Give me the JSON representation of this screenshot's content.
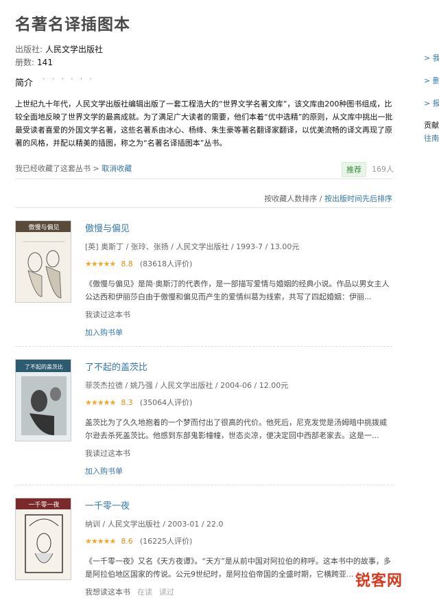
{
  "header": {
    "title": "名著名译插图本",
    "publisher_label": "出版社:",
    "publisher": "人民文学出版社",
    "count_label": "册数:",
    "count": "141",
    "intro_heading": "简介",
    "dots": "· · · · · ·",
    "description": "上世纪九十年代，人民文学出版社编辑出版了一套工程浩大的“世界文学名著文库”，该文库由200种图书组成，比较全面地反映了世界文学的最高成就。为了满足广大读者的需要，他们本着“优中选精”的原则，从文库中挑出一批最受读者喜爱的外国文学名著，这些名著系由冰心、杨绛、朱生豪等著名翻译家翻译，以优美流畅的译文再现了原著的风格，并配以精美的插图，称之为“名著名译插图本”丛书。"
  },
  "collect": {
    "text": "我已经收藏了这套丛书 >",
    "cancel": "取消收藏",
    "recommend": "推荐",
    "recommend_count": "169人"
  },
  "sort": {
    "by_collect": "按收藏人数排序",
    "sep": "/",
    "by_time": "按出版时间先后排序"
  },
  "books": [
    {
      "title": "傲慢与偏见",
      "pub": "[英] 奥斯丁 / 张玲、张扬 / 人民文学出版社 / 1993-7 / 13.00元",
      "stars": "★★★★★",
      "score": "8.8",
      "ratings": "(83618人评价)",
      "desc": "《傲慢与偏见》是简·奥斯汀的代表作，是一部描写爱情与婚姻的经典小说。作品以男女主人公达西和伊丽莎白由于傲慢和偏见而产生的爱情纠葛为线索，共写了四起婚姻：伊丽...",
      "read": "我读过这本书",
      "cart": "加入购书单",
      "cover_title": "傲慢与偏见"
    },
    {
      "title": "了不起的盖茨比",
      "pub": "菲茨杰拉德 / 姚乃强 / 人民文学出版社 / 2004-06 / 12.00元",
      "stars": "★★★★★",
      "score": "8.3",
      "ratings": "(35064人评价)",
      "desc": "盖茨比为了久久地抱着的一个梦而付出了很高的代价。他死后，尼克发觉是汤姆暗中挑拨威尔逊去杀死盖茨比。他感到东部鬼影幢幢，世态炎凉，便决定回中西部老家去。这是一...",
      "read": "我读过这本书",
      "cart": "加入购书单",
      "cover_title": "了不起的盖茨比"
    },
    {
      "title": "一千零一夜",
      "pub": "纳训 / 人民文学出版社 / 2003-01 / 22.0",
      "stars": "★★★★★",
      "score": "8.6",
      "ratings": "(16225人评价)",
      "desc": "《一千零一夜》又名《天方夜谭》。“天方”是从前中国对阿拉伯的称呼。这本书中的故事，多是阿拉伯地区国家的传说。公元9世纪时，是阿拉伯帝国的全盛时期，它横跨亚...",
      "read": "我想读这本书",
      "reading": "在读",
      "readed": "读过",
      "cover_title": "一千零一夜"
    }
  ],
  "sidebar": {
    "link1": "> 我",
    "link2": "> 删",
    "link3": "> 报",
    "text1": "贡献",
    "link4": "往南"
  },
  "watermark": "锐客网"
}
